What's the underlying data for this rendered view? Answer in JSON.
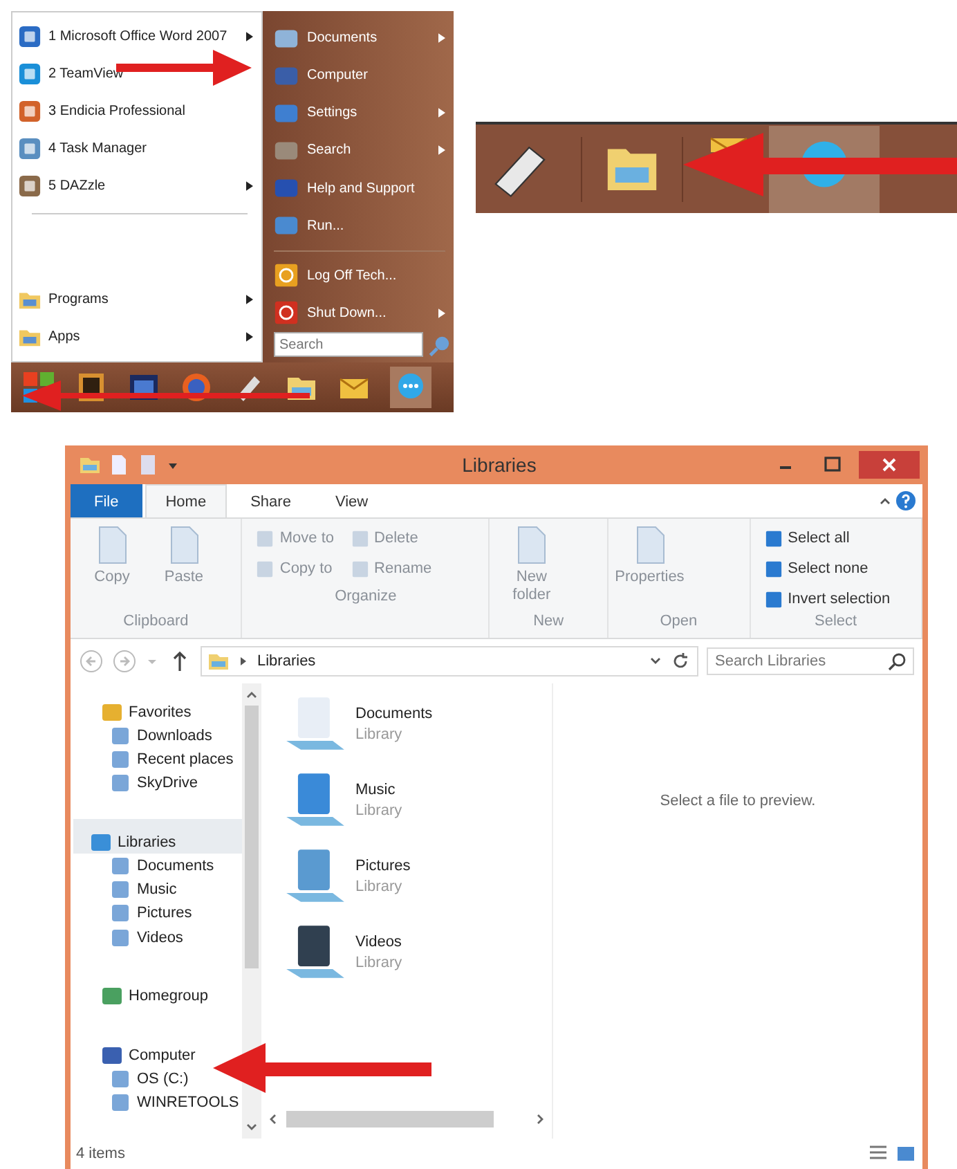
{
  "start_menu": {
    "recent": [
      {
        "label": "1 Microsoft Office Word 2007",
        "has_submenu": true
      },
      {
        "label": "2 TeamView",
        "has_submenu": false
      },
      {
        "label": "3 Endicia Professional",
        "has_submenu": false
      },
      {
        "label": "4 Task Manager",
        "has_submenu": false
      },
      {
        "label": "5 DAZzle",
        "has_submenu": true
      }
    ],
    "folders": [
      {
        "label": "Programs",
        "has_submenu": true
      },
      {
        "label": "Apps",
        "has_submenu": true
      }
    ],
    "places": [
      {
        "label": "Documents",
        "has_submenu": true
      },
      {
        "label": "Computer",
        "has_submenu": false
      },
      {
        "label": "Settings",
        "has_submenu": true
      },
      {
        "label": "Search",
        "has_submenu": true
      },
      {
        "label": "Help and Support",
        "has_submenu": false
      },
      {
        "label": "Run...",
        "has_submenu": false
      }
    ],
    "session": [
      {
        "label": "Log Off Tech...",
        "has_submenu": false
      },
      {
        "label": "Shut Down...",
        "has_submenu": true
      }
    ],
    "search": {
      "placeholder": "Search"
    }
  },
  "explorer": {
    "title": "Libraries",
    "tabs": [
      {
        "label": "File",
        "kind": "menu",
        "selected": false
      },
      {
        "label": "Home",
        "kind": "tab",
        "selected": true
      },
      {
        "label": "Share",
        "kind": "tab",
        "selected": false
      },
      {
        "label": "View",
        "kind": "tab",
        "selected": false
      }
    ],
    "groups": [
      {
        "label": "Clipboard",
        "commands": [
          {
            "label": "Copy",
            "kind": "large"
          },
          {
            "label": "Paste",
            "kind": "large"
          }
        ]
      },
      {
        "label": "Organize",
        "commands": [
          {
            "label": "Move to",
            "kind": "small"
          },
          {
            "label": "Copy to",
            "kind": "small"
          },
          {
            "label": "Delete",
            "kind": "small"
          },
          {
            "label": "Rename",
            "kind": "small"
          }
        ]
      },
      {
        "label": "New",
        "commands": [
          {
            "label": "New folder",
            "kind": "large"
          }
        ]
      },
      {
        "label": "Open",
        "commands": [
          {
            "label": "Properties",
            "kind": "large"
          }
        ]
      },
      {
        "label": "Select",
        "commands": [
          {
            "label": "Select all",
            "kind": "small"
          },
          {
            "label": "Select none",
            "kind": "small"
          },
          {
            "label": "Invert selection",
            "kind": "small"
          }
        ]
      }
    ],
    "path": "Libraries",
    "search": {
      "placeholder": "Search Libraries"
    },
    "nav": [
      {
        "label": "Favorites",
        "selected": false,
        "children": [
          {
            "label": "Downloads",
            "selected": false
          },
          {
            "label": "Recent places",
            "selected": false
          },
          {
            "label": "SkyDrive",
            "selected": false
          }
        ]
      },
      {
        "label": "Libraries",
        "selected": true,
        "children": [
          {
            "label": "Documents",
            "selected": false
          },
          {
            "label": "Music",
            "selected": false
          },
          {
            "label": "Pictures",
            "selected": false
          },
          {
            "label": "Videos",
            "selected": false
          }
        ]
      },
      {
        "label": "Homegroup",
        "selected": false
      },
      {
        "label": "Computer",
        "selected": false,
        "children": [
          {
            "label": "OS (C:)",
            "selected": false
          },
          {
            "label": "WINRETOOLS",
            "selected": false
          }
        ]
      }
    ],
    "items": [
      {
        "name": "Documents",
        "type": "Library"
      },
      {
        "name": "Music",
        "type": "Library"
      },
      {
        "name": "Pictures",
        "type": "Library"
      },
      {
        "name": "Videos",
        "type": "Library"
      }
    ],
    "preview": "Select a file to preview.",
    "status": "4 items"
  }
}
